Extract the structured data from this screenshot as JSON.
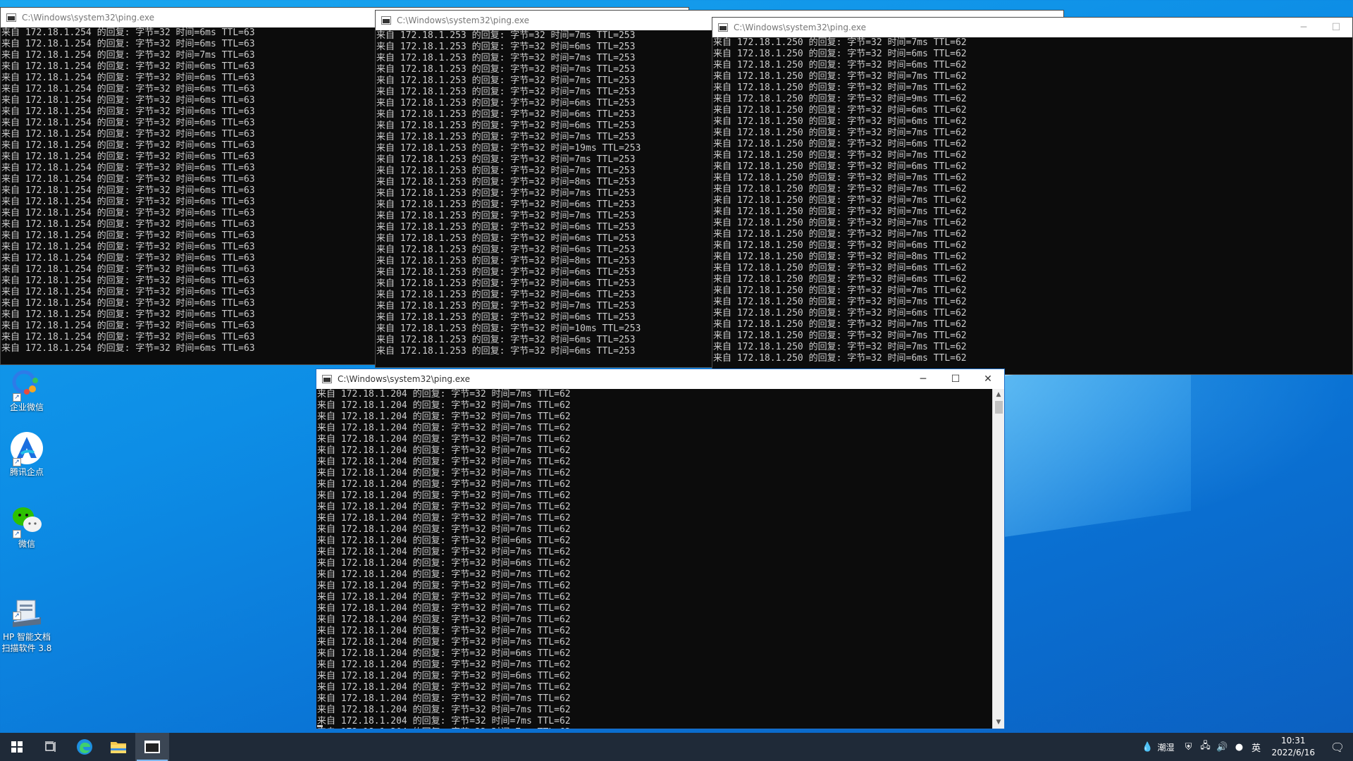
{
  "desktop": {
    "icons": [
      {
        "label": "企业微信",
        "icon": "wecom-icon"
      },
      {
        "label": "腾讯企点",
        "icon": "qidian-icon"
      },
      {
        "label": "微信",
        "icon": "wechat-icon"
      },
      {
        "label": "HP 智能文档\n扫描软件 3.8",
        "icon": "hp-scan-icon"
      }
    ]
  },
  "windows": [
    {
      "id": "win1",
      "title": "C:\\Windows\\system32\\ping.exe",
      "active": false,
      "host": "172.18.1.254",
      "ttl": "63",
      "times": [
        "6",
        "6",
        "7",
        "6",
        "6",
        "6",
        "6",
        "6",
        "6",
        "6",
        "6",
        "6",
        "6",
        "6",
        "6",
        "6",
        "6",
        "6",
        "6",
        "6",
        "6",
        "6",
        "6",
        "6",
        "6",
        "6",
        "6",
        "6",
        "6"
      ]
    },
    {
      "id": "win2",
      "title": "C:\\Windows\\system32\\ping.exe",
      "active": false,
      "host": "172.18.1.253",
      "ttl": "253",
      "times": [
        "7",
        "6",
        "7",
        "7",
        "7",
        "7",
        "6",
        "6",
        "6",
        "7",
        "19",
        "7",
        "7",
        "8",
        "7",
        "6",
        "7",
        "6",
        "6",
        "6",
        "8",
        "6",
        "6",
        "6",
        "7",
        "6",
        "10",
        "6",
        "6"
      ]
    },
    {
      "id": "win3",
      "title": "C:\\Windows\\system32\\ping.exe",
      "active": false,
      "host": "172.18.1.250",
      "ttl": "62",
      "times": [
        "7",
        "6",
        "6",
        "7",
        "7",
        "9",
        "6",
        "6",
        "7",
        "6",
        "7",
        "6",
        "7",
        "7",
        "7",
        "7",
        "7",
        "7",
        "6",
        "8",
        "6",
        "6",
        "7",
        "7",
        "6",
        "7",
        "7",
        "7",
        "6"
      ]
    },
    {
      "id": "win4",
      "title": "C:\\Windows\\system32\\ping.exe",
      "active": true,
      "host": "172.18.1.204",
      "ttl": "62",
      "times": [
        "7",
        "7",
        "7",
        "7",
        "7",
        "7",
        "7",
        "7",
        "7",
        "7",
        "7",
        "7",
        "7",
        "6",
        "7",
        "6",
        "7",
        "7",
        "7",
        "7",
        "7",
        "7",
        "7",
        "6",
        "7",
        "6",
        "7",
        "7",
        "7",
        "7",
        "7"
      ]
    }
  ],
  "line_template": {
    "prefix": "来自 ",
    "reply": " 的回复: 字节=32 时间=",
    "ms": "ms TTL="
  },
  "window_buttons": {
    "minimize": "─",
    "maximize": "☐",
    "close": "✕"
  },
  "taskbar": {
    "weather": "潮湿",
    "ime": "英",
    "time": "10:31",
    "date": "2022/6/16"
  }
}
